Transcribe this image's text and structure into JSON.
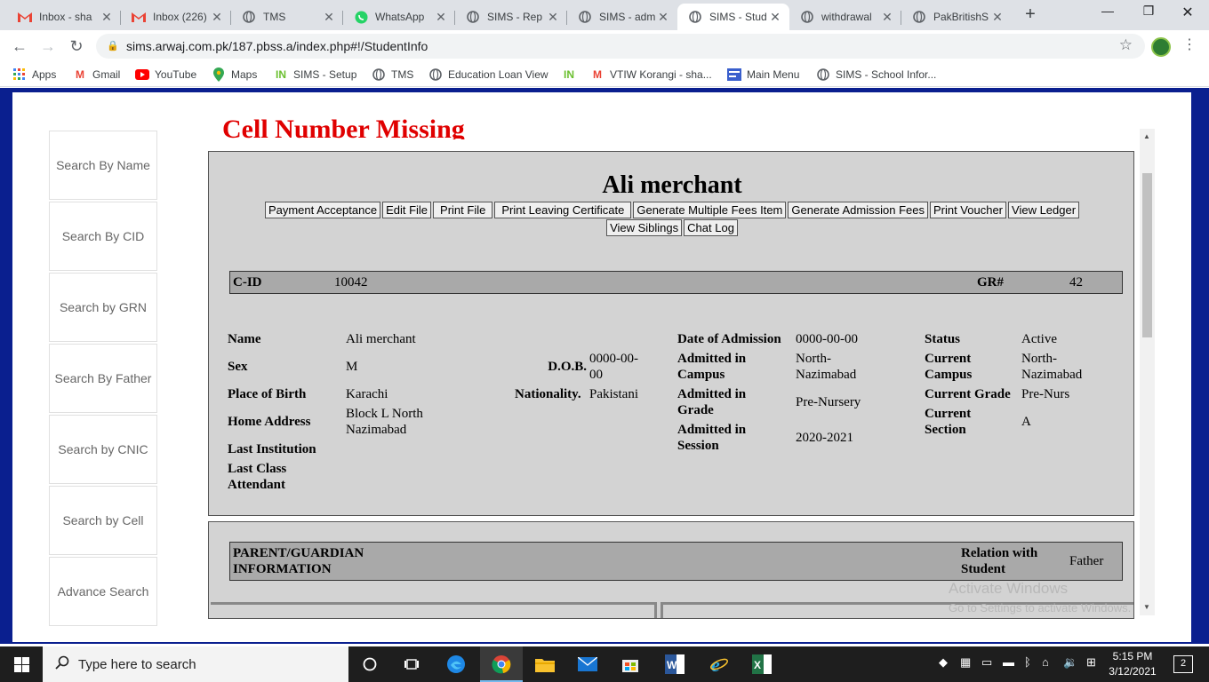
{
  "tabs": [
    {
      "title": "Inbox - sha",
      "icon": "gmail-icon"
    },
    {
      "title": "Inbox (226)",
      "icon": "gmail-icon"
    },
    {
      "title": "TMS",
      "icon": "globe-icon"
    },
    {
      "title": "WhatsApp",
      "icon": "whatsapp-icon"
    },
    {
      "title": "SIMS - Rep",
      "icon": "globe-icon"
    },
    {
      "title": "SIMS - adm",
      "icon": "globe-icon"
    },
    {
      "title": "SIMS - Stud",
      "icon": "globe-icon",
      "active": true
    },
    {
      "title": "withdrawal",
      "icon": "globe-icon"
    },
    {
      "title": "PakBritishS",
      "icon": "globe-icon"
    }
  ],
  "address_bar": {
    "url": "sims.arwaj.com.pk/187.pbss.a/index.php#!/StudentInfo"
  },
  "bookmarks": [
    {
      "label": "Apps",
      "icon": "apps-grid-icon"
    },
    {
      "label": "Gmail",
      "icon": "gmail-icon"
    },
    {
      "label": "YouTube",
      "icon": "youtube-icon"
    },
    {
      "label": "Maps",
      "icon": "maps-pin-icon"
    },
    {
      "label": "SIMS - Setup",
      "icon": "in-logo-icon"
    },
    {
      "label": "TMS",
      "icon": "globe-icon"
    },
    {
      "label": "Education Loan View",
      "icon": "globe-icon"
    },
    {
      "label": "",
      "icon": "in-logo-icon"
    },
    {
      "label": "VTIW Korangi - sha...",
      "icon": "gmail-icon"
    },
    {
      "label": "Main Menu",
      "icon": "form-icon"
    },
    {
      "label": "SIMS - School Infor...",
      "icon": "globe-icon"
    }
  ],
  "sidebar": {
    "items": [
      {
        "label": "Search By Name"
      },
      {
        "label": "Search By CID"
      },
      {
        "label": "Search by GRN"
      },
      {
        "label": "Search By Father"
      },
      {
        "label": "Search by CNIC"
      },
      {
        "label": "Search by Cell"
      },
      {
        "label": "Advance Search"
      }
    ]
  },
  "alert": {
    "text": "Cell Number Missing"
  },
  "student": {
    "name_heading": "Ali merchant",
    "actions_row1": [
      "Payment Acceptance",
      "Edit File",
      "Print File",
      "Print Leaving Certificate",
      "Generate Multiple Fees Item",
      "Generate Admission Fees",
      "Print Voucher",
      "View Ledger"
    ],
    "actions_row2": [
      "View Siblings",
      "Chat Log"
    ],
    "cid_label": "C-ID",
    "cid_value": "10042",
    "gr_label": "GR#",
    "gr_value": "42",
    "fields": {
      "name_label": "Name",
      "name_value": "Ali merchant",
      "sex_label": "Sex",
      "sex_value": "M",
      "dob_label": "D.O.B.",
      "dob_value": "0000-00-00",
      "pob_label": "Place of Birth",
      "pob_value": "Karachi",
      "nationality_label": "Nationality.",
      "nationality_value": "Pakistani",
      "address_label": "Home Address",
      "address_value": "Block L North Nazimabad",
      "last_institution_label": "Last Institution",
      "last_class_label": "Last Class Attendant",
      "doa_label": "Date of Admission",
      "doa_value": "0000-00-00",
      "adm_campus_label": "Admitted in Campus",
      "adm_campus_value": "North-Nazimabad",
      "adm_grade_label": "Admitted in Grade",
      "adm_grade_value": "Pre-Nursery",
      "adm_session_label": "Admitted in Session",
      "adm_session_value": "2020-2021",
      "status_label": "Status",
      "status_value": "Active",
      "cur_campus_label": "Current Campus",
      "cur_campus_value": "North-Nazimabad",
      "cur_grade_label": "Current Grade",
      "cur_grade_value": "Pre-Nurs",
      "cur_section_label": "Current Section",
      "cur_section_value": "A"
    }
  },
  "guardian": {
    "heading": "PARENT/GUARDIAN INFORMATION",
    "relation_label": "Relation with Student",
    "relation_value": "Father"
  },
  "watermark": {
    "line1": "Activate Windows",
    "line2": "Go to Settings to activate Windows."
  },
  "taskbar": {
    "search_placeholder": "Type here to search",
    "time": "5:15 PM",
    "date": "3/12/2021",
    "notification_count": "2"
  },
  "colors": {
    "page_frame": "#0a1f8f",
    "alert_red": "#e00000",
    "panel_grey": "#d3d3d3",
    "header_bar": "#a9a9a9"
  }
}
